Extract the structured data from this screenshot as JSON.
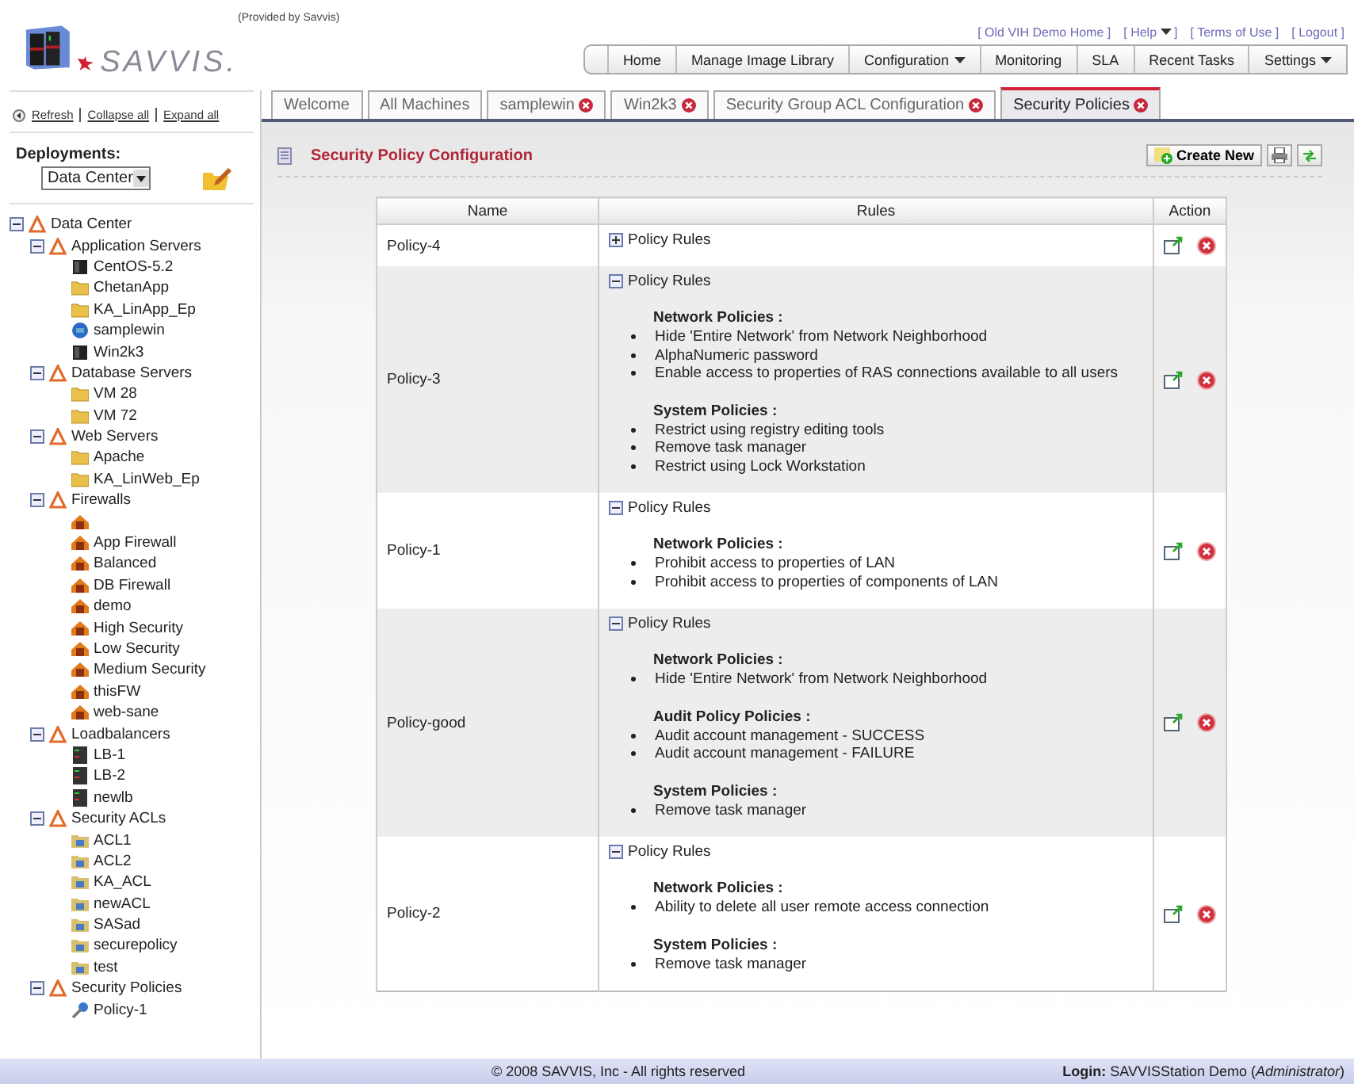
{
  "header": {
    "logo_text": "SAVVIS.",
    "provided_by": "(Provided by Savvis)",
    "top_links": [
      {
        "label": "[ Old VIH Demo Home ]",
        "dropdown": false
      },
      {
        "label": "[ Help",
        "dropdown": true,
        "suffix": "]"
      },
      {
        "label": "[ Terms of Use ]",
        "dropdown": false
      },
      {
        "label": "[ Logout ]",
        "dropdown": false
      }
    ],
    "nav": [
      {
        "label": "Home",
        "dropdown": false
      },
      {
        "label": "Manage Image Library",
        "dropdown": false
      },
      {
        "label": "Configuration",
        "dropdown": true
      },
      {
        "label": "Monitoring",
        "dropdown": false
      },
      {
        "label": "SLA",
        "dropdown": false
      },
      {
        "label": "Recent Tasks",
        "dropdown": false
      },
      {
        "label": "Settings",
        "dropdown": true
      }
    ]
  },
  "sidebar": {
    "links": [
      "Refresh",
      "Collapse all",
      "Expand all"
    ],
    "deployments_label": "Deployments:",
    "deployment_value": "Data Center",
    "tree": [
      {
        "label": "Data Center",
        "kind": "group",
        "expanded": true,
        "children": [
          {
            "label": "Application Servers",
            "kind": "group",
            "expanded": true,
            "children": [
              {
                "label": "CentOS-5.2",
                "kind": "server"
              },
              {
                "label": "ChetanApp",
                "kind": "folder"
              },
              {
                "label": "KA_LinApp_Ep",
                "kind": "folder"
              },
              {
                "label": "samplewin",
                "kind": "windows"
              },
              {
                "label": "Win2k3",
                "kind": "server"
              }
            ]
          },
          {
            "label": "Database Servers",
            "kind": "group",
            "expanded": true,
            "children": [
              {
                "label": "VM 28",
                "kind": "folder"
              },
              {
                "label": "VM 72",
                "kind": "folder"
              }
            ]
          },
          {
            "label": "Web Servers",
            "kind": "group",
            "expanded": true,
            "children": [
              {
                "label": "Apache",
                "kind": "folder"
              },
              {
                "label": "KA_LinWeb_Ep",
                "kind": "folder"
              }
            ]
          },
          {
            "label": "Firewalls",
            "kind": "group",
            "expanded": true,
            "children": [
              {
                "kind": "firewall"
              },
              {
                "label": "App Firewall",
                "kind": "firewall"
              },
              {
                "label": "Balanced",
                "kind": "firewall"
              },
              {
                "label": "DB Firewall",
                "kind": "firewall"
              },
              {
                "label": "demo",
                "kind": "firewall"
              },
              {
                "label": "High Security",
                "kind": "firewall"
              },
              {
                "label": "Low Security",
                "kind": "firewall"
              },
              {
                "label": "Medium Security",
                "kind": "firewall"
              },
              {
                "label": "thisFW",
                "kind": "firewall"
              },
              {
                "label": "web-sane",
                "kind": "firewall"
              }
            ]
          },
          {
            "label": "Loadbalancers",
            "kind": "group",
            "expanded": true,
            "children": [
              {
                "label": "LB-1",
                "kind": "loadbalancer"
              },
              {
                "label": "LB-2",
                "kind": "loadbalancer"
              },
              {
                "label": "newlb",
                "kind": "loadbalancer"
              }
            ]
          },
          {
            "label": "Security ACLs",
            "kind": "group",
            "expanded": true,
            "children": [
              {
                "label": "ACL1",
                "kind": "acl"
              },
              {
                "label": "ACL2",
                "kind": "acl"
              },
              {
                "label": "KA_ACL",
                "kind": "acl"
              },
              {
                "label": "newACL",
                "kind": "acl"
              },
              {
                "label": "SASad",
                "kind": "acl"
              },
              {
                "label": "securepolicy",
                "kind": "acl"
              },
              {
                "label": "test",
                "kind": "acl"
              }
            ]
          },
          {
            "label": "Security Policies",
            "kind": "group",
            "expanded": true,
            "children": [
              {
                "label": "Policy-1",
                "kind": "policy"
              }
            ]
          }
        ]
      }
    ]
  },
  "tabs": [
    {
      "label": "Welcome",
      "closable": false,
      "selected": false
    },
    {
      "label": "All Machines",
      "closable": false,
      "selected": false
    },
    {
      "label": "samplewin",
      "closable": true,
      "selected": false
    },
    {
      "label": "Win2k3",
      "closable": true,
      "selected": false
    },
    {
      "label": "Security Group ACL Configuration",
      "closable": true,
      "selected": false
    },
    {
      "label": "Security Policies",
      "closable": true,
      "selected": true
    }
  ],
  "panel": {
    "title": "Security Policy Configuration",
    "create_button": "Create New",
    "table": {
      "columns": [
        "Name",
        "Rules",
        "Action"
      ],
      "rows": [
        {
          "name": "Policy-4",
          "rules_label": "Policy Rules",
          "expanded": false,
          "sections": []
        },
        {
          "name": "Policy-3",
          "rules_label": "Policy Rules",
          "expanded": true,
          "sections": [
            {
              "title": "Network Policies :",
              "items": [
                "Hide 'Entire Network' from Network Neighborhood",
                "AlphaNumeric password",
                "Enable access to properties of RAS connections available to all users"
              ]
            },
            {
              "title": "System Policies :",
              "items": [
                "Restrict using registry editing tools",
                "Remove task manager",
                "Restrict using Lock Workstation"
              ]
            }
          ]
        },
        {
          "name": "Policy-1",
          "rules_label": "Policy Rules",
          "expanded": true,
          "sections": [
            {
              "title": "Network Policies :",
              "items": [
                "Prohibit access to properties of LAN",
                "Prohibit access to properties of components of LAN"
              ]
            }
          ]
        },
        {
          "name": "Policy-good",
          "rules_label": "Policy Rules",
          "expanded": true,
          "sections": [
            {
              "title": "Network Policies :",
              "items": [
                "Hide 'Entire Network' from Network Neighborhood"
              ]
            },
            {
              "title": "Audit Policy Policies :",
              "items": [
                "Audit account management - SUCCESS",
                "Audit account management - FAILURE"
              ]
            },
            {
              "title": "System Policies :",
              "items": [
                "Remove task manager"
              ]
            }
          ]
        },
        {
          "name": "Policy-2",
          "rules_label": "Policy Rules",
          "expanded": true,
          "sections": [
            {
              "title": "Network Policies :",
              "items": [
                "Ability to delete all user remote access connection"
              ]
            },
            {
              "title": "System Policies :",
              "items": [
                "Remove task manager"
              ]
            }
          ]
        }
      ]
    }
  },
  "footer": {
    "copyright": "© 2008 SAVVIS, Inc - All rights reserved",
    "login": "**Login:** SAVVISStation Demo (*Administrator*)"
  }
}
